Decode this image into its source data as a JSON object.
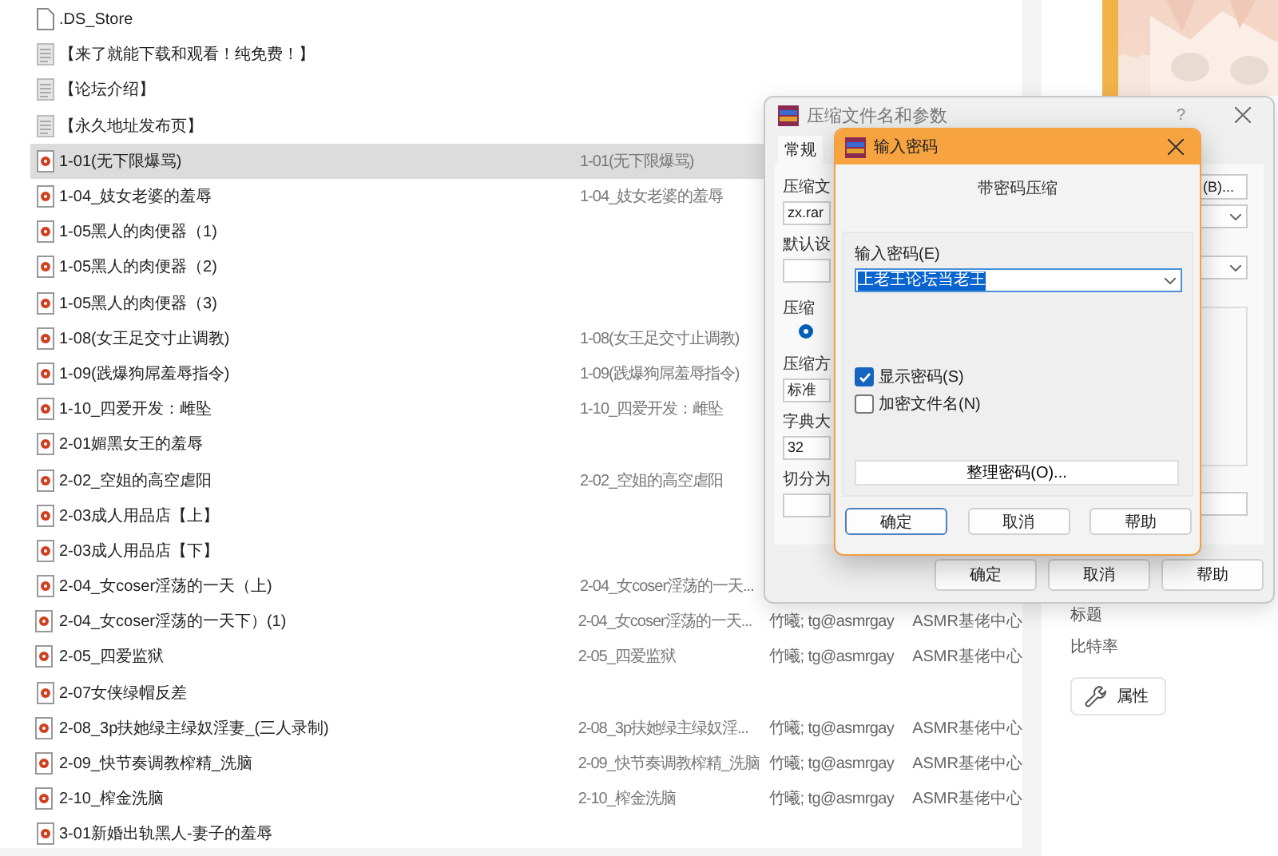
{
  "file_list": {
    "rows": [
      {
        "kind": "blank",
        "name": ".DS_Store",
        "selected": false
      },
      {
        "kind": "text",
        "name": "【来了就能下载和观看！纯免费！】",
        "selected": false
      },
      {
        "kind": "text",
        "name": "【论坛介绍】",
        "selected": false
      },
      {
        "kind": "text",
        "name": "【永久地址发布页】",
        "selected": false
      },
      {
        "kind": "audio",
        "name": "1-01(无下限爆骂)",
        "column_2": "1-01(无下限爆骂)",
        "selected": true
      },
      {
        "kind": "audio",
        "name": "1-04_妓女老婆的羞辱",
        "column_2": "1-04_妓女老婆的羞辱",
        "selected": false
      },
      {
        "kind": "audio",
        "name": "1-05黑人的肉便器（1)",
        "selected": false
      },
      {
        "kind": "audio",
        "name": "1-05黑人的肉便器（2)",
        "selected": false
      },
      {
        "kind": "audio",
        "name": "1-05黑人的肉便器（3)",
        "selected": false
      },
      {
        "kind": "audio",
        "name": "1-08(女王足交寸止调教)",
        "column_2": "1-08(女王足交寸止调教)",
        "selected": false
      },
      {
        "kind": "audio",
        "name": "1-09(践爆狗屌羞辱指令)",
        "column_2": "1-09(践爆狗屌羞辱指令)",
        "selected": false
      },
      {
        "kind": "audio",
        "name": "1-10_四爱开发：雌坠",
        "column_2": "1-10_四爱开发：雌坠",
        "selected": false
      },
      {
        "kind": "audio",
        "name": "2-01媚黑女王的羞辱",
        "selected": false
      },
      {
        "kind": "audio",
        "name": "2-02_空姐的高空虐阳",
        "column_2": "2-02_空姐的高空虐阳",
        "selected": false
      },
      {
        "kind": "audio",
        "name": "2-03成人用品店【上】",
        "selected": false
      },
      {
        "kind": "audio",
        "name": "2-03成人用品店【下】",
        "selected": false
      },
      {
        "kind": "audio",
        "name": "2-04_女coser淫荡的一天（上)",
        "column_2": "2-04_女coser淫荡的一天...",
        "selected": false
      },
      {
        "kind": "audio",
        "name": "2-04_女coser淫荡的一天下）(1)",
        "column_2": "2-04_女coser淫荡的一天...",
        "column_3": "竹曦; tg@asmrgay",
        "column_4": "ASMR基佬中心",
        "selected": false
      },
      {
        "kind": "audio",
        "name": "2-05_四爱监狱",
        "column_2": "2-05_四爱监狱",
        "column_3": "竹曦; tg@asmrgay",
        "column_4": "ASMR基佬中心",
        "selected": false
      },
      {
        "kind": "audio",
        "name": "2-07女侠绿帽反差",
        "selected": false
      },
      {
        "kind": "audio",
        "name": "2-08_3p扶她绿主绿奴淫妻_(三人录制)",
        "column_2": "2-08_3p扶她绿主绿奴淫...",
        "column_3": "竹曦; tg@asmrgay",
        "column_4": "ASMR基佬中心",
        "selected": false
      },
      {
        "kind": "audio",
        "name": "2-09_快节奏调教榨精_洗脑",
        "column_2": "2-09_快节奏调教榨精_洗脑",
        "column_3": "竹曦; tg@asmrgay",
        "column_4": "ASMR基佬中心",
        "selected": false
      },
      {
        "kind": "audio",
        "name": "2-10_榨金洗脑",
        "column_2": "2-10_榨金洗脑",
        "column_3": "竹曦; tg@asmrgay",
        "column_4": "ASMR基佬中心",
        "selected": false
      },
      {
        "kind": "audio",
        "name": "3-01新婚出轨黑人-妻子的羞辱",
        "selected": false
      }
    ]
  },
  "details_pane": {
    "preview": {
      "kind": "picture"
    },
    "labels": [
      "标题",
      "比特率"
    ],
    "properties_button": "属性"
  },
  "archive_dialog": {
    "title": "压缩文件名和参数",
    "help": "?",
    "tabs": [
      {
        "label": "常规",
        "selected": true
      }
    ],
    "left_items": [
      {
        "kind": "label",
        "text": "压缩文"
      },
      {
        "kind": "field",
        "value": "zx.rar"
      },
      {
        "kind": "label",
        "text": "默认设"
      },
      {
        "kind": "field"
      },
      {
        "kind": "group",
        "text": "压缩",
        "selected": true
      },
      {
        "kind": "label",
        "text": "压缩方"
      },
      {
        "kind": "field",
        "value": "标准"
      },
      {
        "kind": "label",
        "text": "字典大"
      },
      {
        "kind": "field",
        "value": "32"
      },
      {
        "kind": "label",
        "text": "切分为"
      },
      {
        "kind": "field"
      }
    ],
    "browse_button": "(B)...",
    "buttons": [
      "确定",
      "取消",
      "帮助"
    ]
  },
  "password_dialog": {
    "title": "输入密码",
    "heading": "带密码压缩",
    "field_label": "输入密码(E)",
    "password": "上老王论坛当老王",
    "options": [
      {
        "label": "显示密码(S)",
        "checked": true
      },
      {
        "label": "加密文件名(N)",
        "checked": false
      }
    ],
    "organize_button": "整理密码(O)...",
    "buttons": [
      {
        "label": "确定",
        "default": true
      },
      {
        "label": "取消",
        "default": false
      },
      {
        "label": "帮助",
        "default": false
      }
    ]
  }
}
